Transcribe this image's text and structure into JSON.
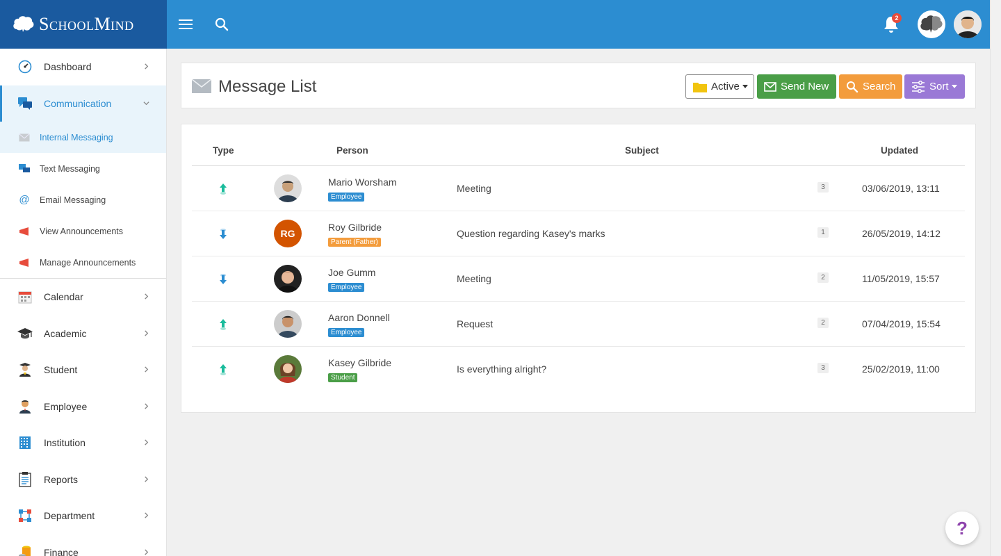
{
  "brand": {
    "name": "SchoolMind"
  },
  "header": {
    "menu_icon": "hamburger-icon",
    "search_icon": "search-icon",
    "notifications_count": "2"
  },
  "sidebar": {
    "items": [
      {
        "label": "Dashboard",
        "icon": "dashboard-icon"
      },
      {
        "label": "Communication",
        "icon": "chat-icon",
        "active": true
      },
      {
        "label": "Calendar",
        "icon": "calendar-icon"
      },
      {
        "label": "Academic",
        "icon": "graduation-cap-icon"
      },
      {
        "label": "Student",
        "icon": "student-icon"
      },
      {
        "label": "Employee",
        "icon": "employee-icon"
      },
      {
        "label": "Institution",
        "icon": "building-icon"
      },
      {
        "label": "Reports",
        "icon": "report-icon"
      },
      {
        "label": "Department",
        "icon": "department-icon"
      },
      {
        "label": "Finance",
        "icon": "coins-icon"
      }
    ],
    "sub_items": [
      {
        "label": "Internal Messaging",
        "icon": "envelope-icon",
        "active": true
      },
      {
        "label": "Text Messaging",
        "icon": "chat-icon"
      },
      {
        "label": "Email Messaging",
        "icon": "at-icon"
      },
      {
        "label": "View Announcements",
        "icon": "megaphone-icon"
      },
      {
        "label": "Manage Announcements",
        "icon": "megaphone-icon"
      }
    ]
  },
  "page": {
    "title": "Message List",
    "buttons": {
      "filter": "Active",
      "send_new": "Send New",
      "search": "Search",
      "sort": "Sort"
    }
  },
  "table": {
    "columns": [
      "Type",
      "Person",
      "Subject",
      "Updated"
    ],
    "rows": [
      {
        "direction": "outgoing",
        "name": "Mario Worsham",
        "role": "Employee",
        "subject": "Meeting",
        "count": "3",
        "updated": "03/06/2019, 13:11"
      },
      {
        "direction": "incoming",
        "initials": "RG",
        "name": "Roy Gilbride",
        "role": "Parent (Father)",
        "subject": "Question regarding Kasey's marks",
        "count": "1",
        "updated": "26/05/2019, 14:12"
      },
      {
        "direction": "incoming",
        "name": "Joe Gumm",
        "role": "Employee",
        "subject": "Meeting",
        "count": "2",
        "updated": "11/05/2019, 15:57"
      },
      {
        "direction": "outgoing",
        "name": "Aaron Donnell",
        "role": "Employee",
        "subject": "Request",
        "count": "2",
        "updated": "07/04/2019, 15:54"
      },
      {
        "direction": "outgoing",
        "name": "Kasey Gilbride",
        "role": "Student",
        "subject": "Is everything alright?",
        "count": "3",
        "updated": "25/02/2019, 11:00"
      }
    ]
  },
  "help": {
    "label": "?"
  },
  "colors": {
    "header": "#2c8dd1",
    "brand_bg": "#1a5a9f",
    "send_button": "#4a9e47",
    "search_button": "#f39c3c",
    "sort_button": "#9a79d6",
    "employee_badge": "#2c8dd1",
    "parent_badge": "#f39c3c",
    "student_badge": "#4a9e47"
  }
}
